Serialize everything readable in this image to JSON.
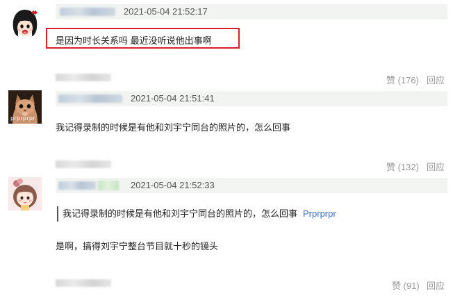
{
  "comments": [
    {
      "timestamp": "2021-05-04 21:52:17",
      "text": "是因为时长关系吗 最近没听说他出事啊",
      "like_label": "赞 (176)",
      "reply_label": "回应"
    },
    {
      "timestamp": "2021-05-04 21:51:41",
      "avatar_caption": "prprprpr",
      "text": "我记得录制的时候是有他和刘宇宁同台的照片的，怎么回事",
      "like_label": "赞 (132)",
      "reply_label": "回应"
    },
    {
      "timestamp": "2021-05-04 21:52:33",
      "quote_text": "我记得录制的时候是有他和刘宇宁同台的照片的，怎么回事",
      "quote_author": "Prprprpr",
      "text": "是啊，搞得刘宇宁整台节目就十秒的镜头",
      "like_label": "赞 (91)",
      "reply_label": "回应"
    }
  ],
  "colors": {
    "meta_bar_bg": "#f1f4f1",
    "highlight_border": "#d9202a",
    "link_blue": "#3b6fb6",
    "muted_text": "#999999"
  }
}
